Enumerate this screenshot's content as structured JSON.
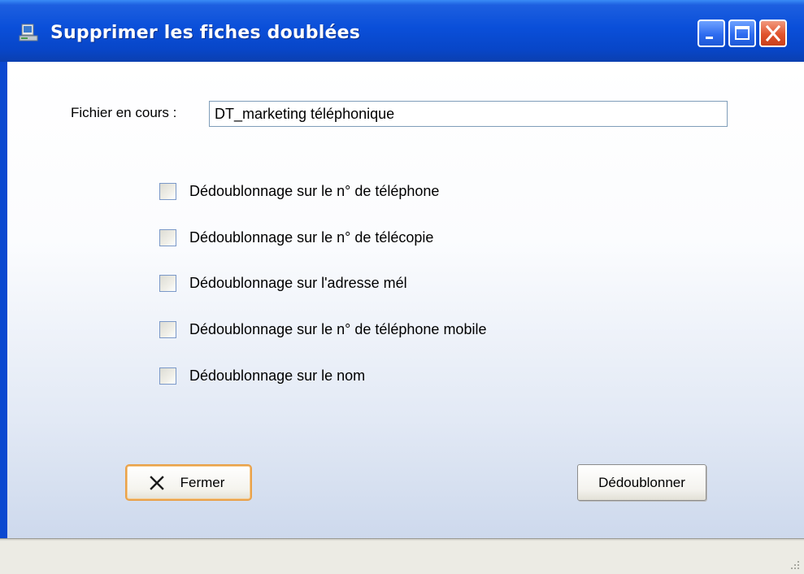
{
  "window": {
    "title": "Supprimer les fiches doublées",
    "app_icon": "app-icon",
    "controls": [
      "minimize-icon",
      "maximize-icon",
      "close-icon"
    ]
  },
  "form": {
    "file_label": "Fichier en cours :",
    "file_value": "DT_marketing téléphonique"
  },
  "options": [
    {
      "label": "Dédoublonnage sur le n° de téléphone",
      "checked": false
    },
    {
      "label": "Dédoublonnage sur le n° de télécopie",
      "checked": false
    },
    {
      "label": "Dédoublonnage sur l'adresse mél",
      "checked": false
    },
    {
      "label": "Dédoublonnage sur le n° de téléphone mobile",
      "checked": false
    },
    {
      "label": "Dédoublonnage sur le nom",
      "checked": false
    }
  ],
  "buttons": {
    "close_label": "Fermer",
    "close_icon": "x-icon",
    "dedup_label": "Dédoublonner"
  },
  "colors": {
    "titlebar": "#0a4fd9",
    "close_button": "#e0532c",
    "focus_border": "#e9a24a"
  }
}
